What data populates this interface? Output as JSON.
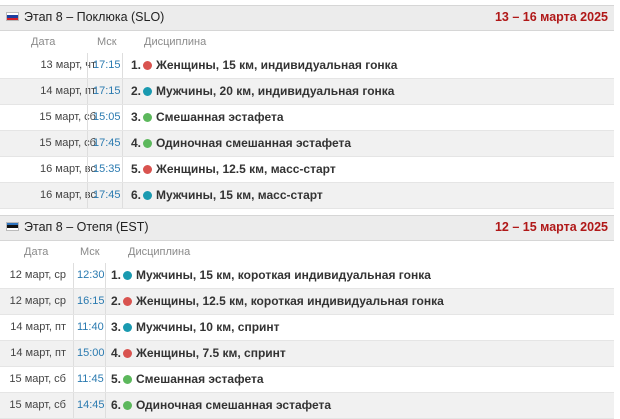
{
  "colors": {
    "red": "#d9534f",
    "teal": "#1a9ab0",
    "green": "#5cb85c",
    "date_accent": "#b01818"
  },
  "columns": {
    "date": "Дата",
    "time": "Мск",
    "discipline": "Дисциплина"
  },
  "stages": [
    {
      "title": "Этап 8 – Поклюка (SLO)",
      "dates": "13 – 16 марта 2025",
      "flag": [
        "#ffffff",
        "#1c3fa0",
        "#d4202a"
      ],
      "events": [
        {
          "date": "13 март, чт",
          "time": "17:15",
          "num": "1.",
          "dot": "red",
          "name": "Женщины, 15 км, индивидуальная гонка"
        },
        {
          "date": "14 март, пт",
          "time": "17:15",
          "num": "2.",
          "dot": "teal",
          "name": "Мужчины, 20 км, индивидуальная гонка"
        },
        {
          "date": "15 март, сб",
          "time": "15:05",
          "num": "3.",
          "dot": "green",
          "name": "Смешанная эстафета"
        },
        {
          "date": "15 март, сб",
          "time": "17:45",
          "num": "4.",
          "dot": "green",
          "name": "Одиночная смешанная эстафета"
        },
        {
          "date": "16 март, вс",
          "time": "15:35",
          "num": "5.",
          "dot": "red",
          "name": "Женщины, 12.5 км, масс-старт"
        },
        {
          "date": "16 март, вс",
          "time": "17:45",
          "num": "6.",
          "dot": "teal",
          "name": "Мужчины, 15 км, масс-старт"
        }
      ]
    },
    {
      "title": "Этап 8 – Отепя (EST)",
      "dates": "12 – 15 марта 2025",
      "flag": [
        "#2f74c0",
        "#111111",
        "#ffffff"
      ],
      "events": [
        {
          "date": "12 март, ср",
          "time": "12:30",
          "num": "1.",
          "dot": "teal",
          "name": "Мужчины, 15 км, короткая индивидуальная гонка"
        },
        {
          "date": "12 март, ср",
          "time": "16:15",
          "num": "2.",
          "dot": "red",
          "name": "Женщины, 12.5 км, короткая индивидуальная гонка"
        },
        {
          "date": "14 март, пт",
          "time": "11:40",
          "num": "3.",
          "dot": "teal",
          "name": "Мужчины, 10 км, спринт"
        },
        {
          "date": "14 март, пт",
          "time": "15:00",
          "num": "4.",
          "dot": "red",
          "name": "Женщины, 7.5 км, спринт"
        },
        {
          "date": "15 март, сб",
          "time": "11:45",
          "num": "5.",
          "dot": "green",
          "name": "Смешанная эстафета"
        },
        {
          "date": "15 март, сб",
          "time": "14:45",
          "num": "6.",
          "dot": "green",
          "name": "Одиночная смешанная эстафета"
        }
      ]
    }
  ]
}
